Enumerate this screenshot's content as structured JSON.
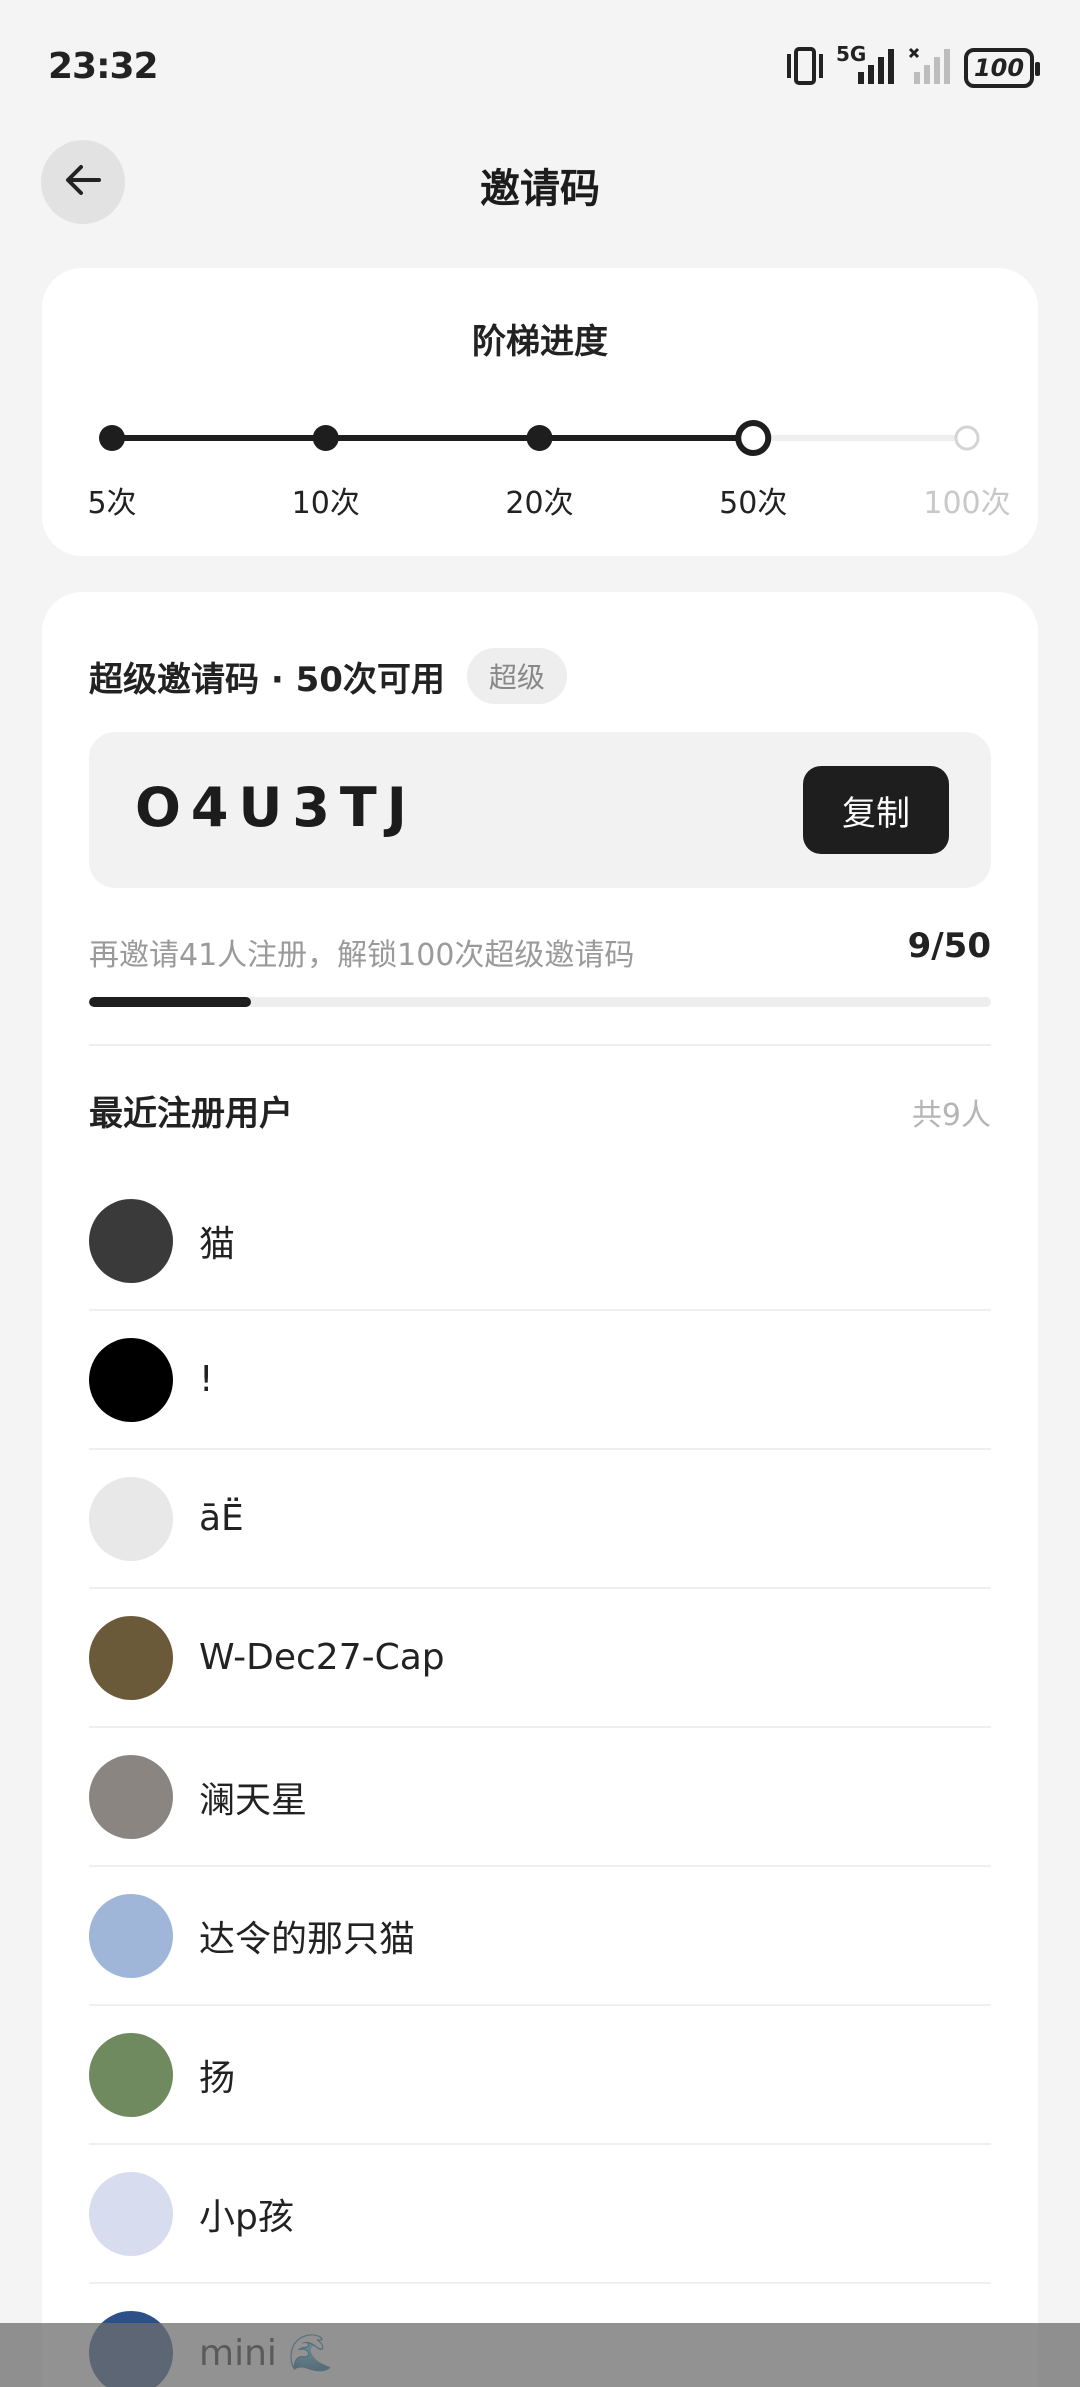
{
  "status_bar": {
    "time": "23:32",
    "battery": "100",
    "network": "5G",
    "icons": [
      "vibrate-icon",
      "signal-icon",
      "signal-off-icon",
      "battery-icon"
    ]
  },
  "header": {
    "title": "邀请码",
    "back_icon": "arrow-left-icon"
  },
  "ladder": {
    "title": "阶梯进度",
    "steps": [
      {
        "label": "5次",
        "state": "done"
      },
      {
        "label": "10次",
        "state": "done"
      },
      {
        "label": "20次",
        "state": "done"
      },
      {
        "label": "50次",
        "state": "current"
      },
      {
        "label": "100次",
        "state": "locked"
      }
    ]
  },
  "invite": {
    "title": "超级邀请码 · 50次可用",
    "badge": "超级",
    "code": "O4U3TJ",
    "copy_label": "复制",
    "progress_text": "再邀请41人注册，解锁100次超级邀请码",
    "progress_count": "9/50",
    "progress_value": 9,
    "progress_max": 50
  },
  "recent": {
    "title": "最近注册用户",
    "count_label": "共9人",
    "users": [
      {
        "name": "猫",
        "avatar_color": "#3a3a3a"
      },
      {
        "name": "!",
        "avatar_color": "#000000"
      },
      {
        "name": "āË",
        "avatar_color": "#e8e8e8"
      },
      {
        "name": "W-Dec27-Cap",
        "avatar_color": "#6b5a3a"
      },
      {
        "name": "澜天星",
        "avatar_color": "#8a8580"
      },
      {
        "name": "达令的那只猫",
        "avatar_color": "#9fb6d8"
      },
      {
        "name": "扬",
        "avatar_color": "#6f8a5e"
      },
      {
        "name": "小p孩",
        "avatar_color": "#d8dcef"
      },
      {
        "name": "mini 🌊",
        "avatar_color": "#2d4f8a"
      }
    ]
  },
  "colors": {
    "background": "#f4f4f4",
    "card": "#ffffff",
    "accent": "#1e1e1e",
    "muted": "#9a9a9a"
  }
}
